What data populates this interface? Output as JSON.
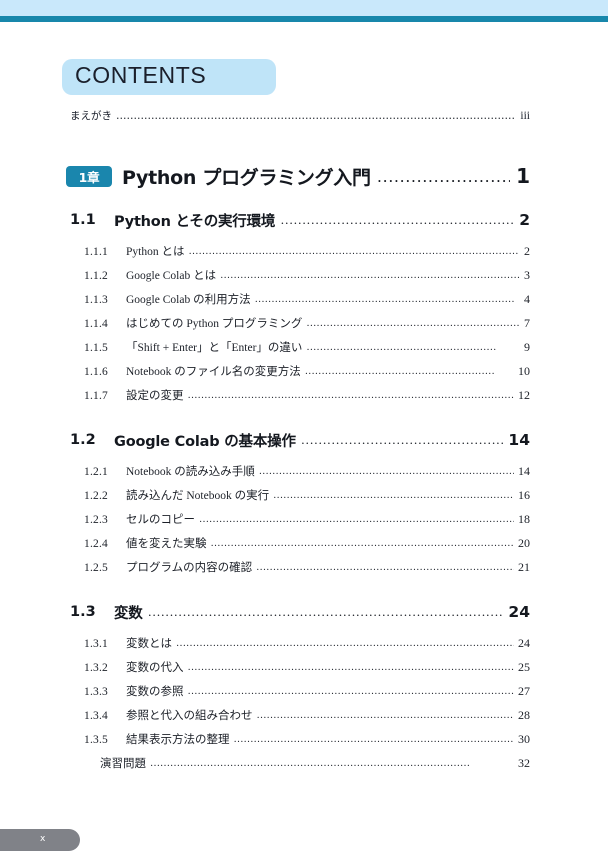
{
  "decor": {
    "band_light_color": "#c9e8fb",
    "band_dark_color": "#1887ab",
    "badge_bg_color": "#bfe4f8",
    "chapter_badge_color": "#1a86ad",
    "footer_tab_color": "#808288"
  },
  "header": {
    "title": "CONTENTS"
  },
  "preface": {
    "label": "まえがき",
    "page": "iii",
    "leader": "……………………………………………………………………………………………………"
  },
  "chapter": {
    "badge": "1章",
    "title": "Python プログラミング入門",
    "page": "1",
    "leader": "…………………………"
  },
  "sections": [
    {
      "number": "1.1",
      "title": "Python とその実行環境",
      "page": "2",
      "leader": "……………………………………………………………",
      "items": [
        {
          "number": "1.1.1",
          "title": "Python とは",
          "page": "2",
          "leader": "………………………………………………………………………………………"
        },
        {
          "number": "1.1.2",
          "title": "Google Colab とは",
          "page": "3",
          "leader": "…………………………………………………………………………………"
        },
        {
          "number": "1.1.3",
          "title": "Google Colab の利用方法",
          "page": "4",
          "leader": "……………………………………………………………………"
        },
        {
          "number": "1.1.4",
          "title": "はじめての Python プログラミング",
          "page": "7",
          "leader": "…………………………………………………………"
        },
        {
          "number": "1.1.5",
          "title": "「Shift + Enter」と「Enter」の違い",
          "page": "9",
          "leader": "…………………………………………………"
        },
        {
          "number": "1.1.6",
          "title": "Notebook のファイル名の変更方法",
          "page": "10",
          "leader": "…………………………………………………"
        },
        {
          "number": "1.1.7",
          "title": "設定の変更",
          "page": "12",
          "leader": "………………………………………………………………………………………"
        }
      ]
    },
    {
      "number": "1.2",
      "title": "Google Colab の基本操作",
      "page": "14",
      "leader": "………………………………………………………",
      "items": [
        {
          "number": "1.2.1",
          "title": "Notebook の読み込み手順",
          "page": "14",
          "leader": "……………………………………………………………………"
        },
        {
          "number": "1.2.2",
          "title": "読み込んだ Notebook の実行",
          "page": "16",
          "leader": "…………………………………………………………………"
        },
        {
          "number": "1.2.3",
          "title": "セルのコピー",
          "page": "18",
          "leader": "……………………………………………………………………………………"
        },
        {
          "number": "1.2.4",
          "title": "値を変えた実験",
          "page": "20",
          "leader": "…………………………………………………………………………………"
        },
        {
          "number": "1.2.5",
          "title": "プログラムの内容の確認",
          "page": "21",
          "leader": "………………………………………………………………………"
        }
      ]
    },
    {
      "number": "1.3",
      "title": "変数",
      "page": "24",
      "leader": "………………………………………………………………………………",
      "items": [
        {
          "number": "1.3.1",
          "title": "変数とは",
          "page": "24",
          "leader": "…………………………………………………………………………………………"
        },
        {
          "number": "1.3.2",
          "title": "変数の代入",
          "page": "25",
          "leader": "………………………………………………………………………………………"
        },
        {
          "number": "1.3.3",
          "title": "変数の参照",
          "page": "27",
          "leader": "………………………………………………………………………………………"
        },
        {
          "number": "1.3.4",
          "title": "参照と代入の組み合わせ",
          "page": "28",
          "leader": "………………………………………………………………………"
        },
        {
          "number": "1.3.5",
          "title": "結果表示方法の整理",
          "page": "30",
          "leader": "……………………………………………………………………………"
        },
        {
          "number": "",
          "title": "演習問題",
          "page": "32",
          "indented": true,
          "leader": "……………………………………………………………………………………"
        }
      ]
    }
  ],
  "footer": {
    "page_number": "x"
  }
}
